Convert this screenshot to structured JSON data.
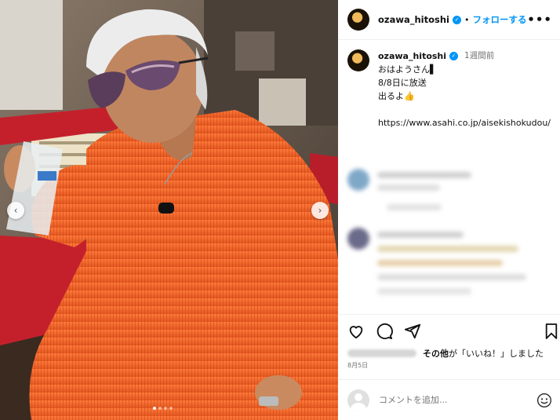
{
  "post": {
    "username": "ozawa_hitoshi",
    "separator": "•",
    "follow_label": "フォローする",
    "more_icon": "more-dots-icon"
  },
  "caption": {
    "username": "ozawa_hitoshi",
    "time": "1週間前",
    "lines": [
      "おはようさん▌",
      "8/8日に放送",
      "出るよ👍"
    ],
    "url": "https://www.asahi.co.jp/aisekishokudou/"
  },
  "photo": {
    "slide_index": 1,
    "slide_count": 4
  },
  "likes": {
    "others_bold": "その他",
    "suffix": "が「いいね！」しました"
  },
  "date": "8月5日",
  "comment": {
    "placeholder": "コメントを追加..."
  },
  "colors": {
    "accent": "#0095f6",
    "jacket": "#f26a2e"
  }
}
